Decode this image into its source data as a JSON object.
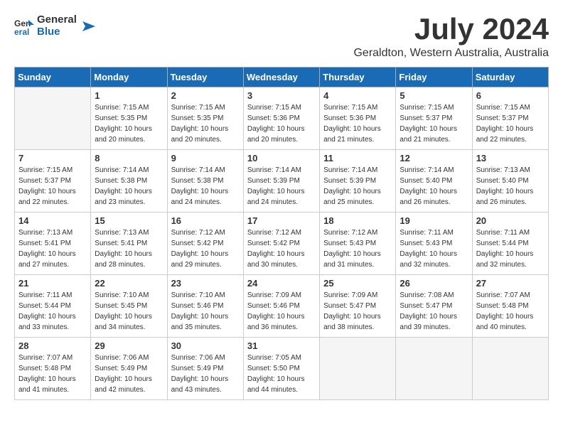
{
  "logo": {
    "general": "General",
    "blue": "Blue"
  },
  "title": "July 2024",
  "location": "Geraldton, Western Australia, Australia",
  "days_of_week": [
    "Sunday",
    "Monday",
    "Tuesday",
    "Wednesday",
    "Thursday",
    "Friday",
    "Saturday"
  ],
  "weeks": [
    [
      {
        "day": "",
        "sunrise": "",
        "sunset": "",
        "daylight": "",
        "empty": true
      },
      {
        "day": "1",
        "sunrise": "Sunrise: 7:15 AM",
        "sunset": "Sunset: 5:35 PM",
        "daylight": "Daylight: 10 hours and 20 minutes."
      },
      {
        "day": "2",
        "sunrise": "Sunrise: 7:15 AM",
        "sunset": "Sunset: 5:35 PM",
        "daylight": "Daylight: 10 hours and 20 minutes."
      },
      {
        "day": "3",
        "sunrise": "Sunrise: 7:15 AM",
        "sunset": "Sunset: 5:36 PM",
        "daylight": "Daylight: 10 hours and 20 minutes."
      },
      {
        "day": "4",
        "sunrise": "Sunrise: 7:15 AM",
        "sunset": "Sunset: 5:36 PM",
        "daylight": "Daylight: 10 hours and 21 minutes."
      },
      {
        "day": "5",
        "sunrise": "Sunrise: 7:15 AM",
        "sunset": "Sunset: 5:37 PM",
        "daylight": "Daylight: 10 hours and 21 minutes."
      },
      {
        "day": "6",
        "sunrise": "Sunrise: 7:15 AM",
        "sunset": "Sunset: 5:37 PM",
        "daylight": "Daylight: 10 hours and 22 minutes."
      }
    ],
    [
      {
        "day": "7",
        "sunrise": "Sunrise: 7:15 AM",
        "sunset": "Sunset: 5:37 PM",
        "daylight": "Daylight: 10 hours and 22 minutes."
      },
      {
        "day": "8",
        "sunrise": "Sunrise: 7:14 AM",
        "sunset": "Sunset: 5:38 PM",
        "daylight": "Daylight: 10 hours and 23 minutes."
      },
      {
        "day": "9",
        "sunrise": "Sunrise: 7:14 AM",
        "sunset": "Sunset: 5:38 PM",
        "daylight": "Daylight: 10 hours and 24 minutes."
      },
      {
        "day": "10",
        "sunrise": "Sunrise: 7:14 AM",
        "sunset": "Sunset: 5:39 PM",
        "daylight": "Daylight: 10 hours and 24 minutes."
      },
      {
        "day": "11",
        "sunrise": "Sunrise: 7:14 AM",
        "sunset": "Sunset: 5:39 PM",
        "daylight": "Daylight: 10 hours and 25 minutes."
      },
      {
        "day": "12",
        "sunrise": "Sunrise: 7:14 AM",
        "sunset": "Sunset: 5:40 PM",
        "daylight": "Daylight: 10 hours and 26 minutes."
      },
      {
        "day": "13",
        "sunrise": "Sunrise: 7:13 AM",
        "sunset": "Sunset: 5:40 PM",
        "daylight": "Daylight: 10 hours and 26 minutes."
      }
    ],
    [
      {
        "day": "14",
        "sunrise": "Sunrise: 7:13 AM",
        "sunset": "Sunset: 5:41 PM",
        "daylight": "Daylight: 10 hours and 27 minutes."
      },
      {
        "day": "15",
        "sunrise": "Sunrise: 7:13 AM",
        "sunset": "Sunset: 5:41 PM",
        "daylight": "Daylight: 10 hours and 28 minutes."
      },
      {
        "day": "16",
        "sunrise": "Sunrise: 7:12 AM",
        "sunset": "Sunset: 5:42 PM",
        "daylight": "Daylight: 10 hours and 29 minutes."
      },
      {
        "day": "17",
        "sunrise": "Sunrise: 7:12 AM",
        "sunset": "Sunset: 5:42 PM",
        "daylight": "Daylight: 10 hours and 30 minutes."
      },
      {
        "day": "18",
        "sunrise": "Sunrise: 7:12 AM",
        "sunset": "Sunset: 5:43 PM",
        "daylight": "Daylight: 10 hours and 31 minutes."
      },
      {
        "day": "19",
        "sunrise": "Sunrise: 7:11 AM",
        "sunset": "Sunset: 5:43 PM",
        "daylight": "Daylight: 10 hours and 32 minutes."
      },
      {
        "day": "20",
        "sunrise": "Sunrise: 7:11 AM",
        "sunset": "Sunset: 5:44 PM",
        "daylight": "Daylight: 10 hours and 32 minutes."
      }
    ],
    [
      {
        "day": "21",
        "sunrise": "Sunrise: 7:11 AM",
        "sunset": "Sunset: 5:44 PM",
        "daylight": "Daylight: 10 hours and 33 minutes."
      },
      {
        "day": "22",
        "sunrise": "Sunrise: 7:10 AM",
        "sunset": "Sunset: 5:45 PM",
        "daylight": "Daylight: 10 hours and 34 minutes."
      },
      {
        "day": "23",
        "sunrise": "Sunrise: 7:10 AM",
        "sunset": "Sunset: 5:46 PM",
        "daylight": "Daylight: 10 hours and 35 minutes."
      },
      {
        "day": "24",
        "sunrise": "Sunrise: 7:09 AM",
        "sunset": "Sunset: 5:46 PM",
        "daylight": "Daylight: 10 hours and 36 minutes."
      },
      {
        "day": "25",
        "sunrise": "Sunrise: 7:09 AM",
        "sunset": "Sunset: 5:47 PM",
        "daylight": "Daylight: 10 hours and 38 minutes."
      },
      {
        "day": "26",
        "sunrise": "Sunrise: 7:08 AM",
        "sunset": "Sunset: 5:47 PM",
        "daylight": "Daylight: 10 hours and 39 minutes."
      },
      {
        "day": "27",
        "sunrise": "Sunrise: 7:07 AM",
        "sunset": "Sunset: 5:48 PM",
        "daylight": "Daylight: 10 hours and 40 minutes."
      }
    ],
    [
      {
        "day": "28",
        "sunrise": "Sunrise: 7:07 AM",
        "sunset": "Sunset: 5:48 PM",
        "daylight": "Daylight: 10 hours and 41 minutes."
      },
      {
        "day": "29",
        "sunrise": "Sunrise: 7:06 AM",
        "sunset": "Sunset: 5:49 PM",
        "daylight": "Daylight: 10 hours and 42 minutes."
      },
      {
        "day": "30",
        "sunrise": "Sunrise: 7:06 AM",
        "sunset": "Sunset: 5:49 PM",
        "daylight": "Daylight: 10 hours and 43 minutes."
      },
      {
        "day": "31",
        "sunrise": "Sunrise: 7:05 AM",
        "sunset": "Sunset: 5:50 PM",
        "daylight": "Daylight: 10 hours and 44 minutes."
      },
      {
        "day": "",
        "sunrise": "",
        "sunset": "",
        "daylight": "",
        "empty": true
      },
      {
        "day": "",
        "sunrise": "",
        "sunset": "",
        "daylight": "",
        "empty": true
      },
      {
        "day": "",
        "sunrise": "",
        "sunset": "",
        "daylight": "",
        "empty": true
      }
    ]
  ]
}
